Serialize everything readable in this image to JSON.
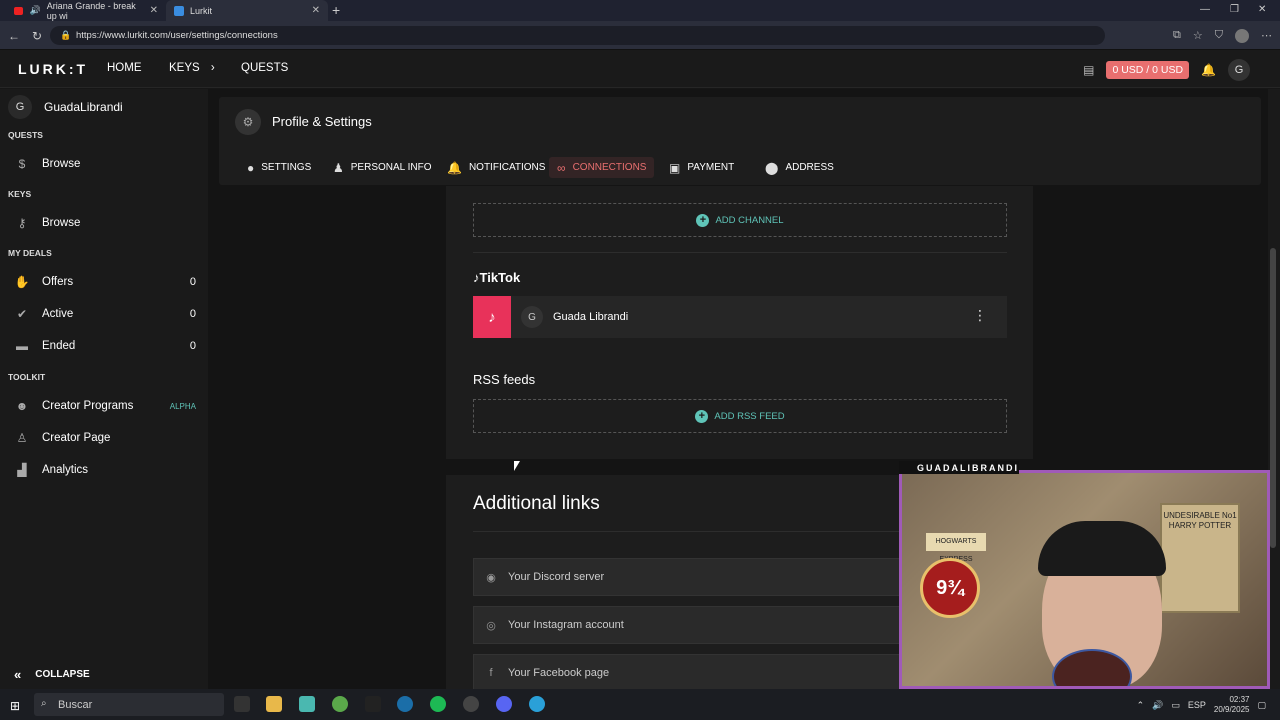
{
  "browser": {
    "tabs": [
      {
        "label": "Ariana Grande - break up wi",
        "icon": "youtube-icon"
      },
      {
        "label": "Lurkit",
        "icon": "lurkit-icon"
      }
    ],
    "url": "https://www.lurkit.com/user/settings/connections"
  },
  "topnav": {
    "logo": "LURK:T",
    "items": [
      "HOME",
      "KEYS",
      "QUESTS"
    ],
    "balance": "0 USD / 0 USD",
    "avatar": "G"
  },
  "sidebar": {
    "user_initial": "G",
    "username": "GuadaLibrandi",
    "sections": {
      "quests": "QUESTS",
      "keys": "KEYS",
      "my_deals": "MY DEALS",
      "toolkit": "TOOLKIT"
    },
    "quests_browse": "Browse",
    "keys_browse": "Browse",
    "deals": [
      {
        "label": "Offers",
        "count": "0"
      },
      {
        "label": "Active",
        "count": "0"
      },
      {
        "label": "Ended",
        "count": "0"
      }
    ],
    "toolkit": [
      {
        "label": "Creator Programs",
        "tag": "ALPHA"
      },
      {
        "label": "Creator Page"
      },
      {
        "label": "Analytics"
      }
    ],
    "collapse": "COLLAPSE"
  },
  "settings": {
    "title": "Profile & Settings",
    "tabs": [
      "SETTINGS",
      "PERSONAL INFO",
      "NOTIFICATIONS",
      "CONNECTIONS",
      "PAYMENT",
      "ADDRESS"
    ],
    "active_tab": "CONNECTIONS"
  },
  "connections": {
    "add_channel": "ADD CHANNEL",
    "tiktok_heading": "TikTok",
    "tiktok_avatar": "G",
    "tiktok_name": "Guada Librandi",
    "rss_heading": "RSS feeds",
    "add_rss": "ADD RSS FEED"
  },
  "additional": {
    "heading": "Additional links",
    "placeholders": [
      "Your Discord server",
      "Your Instagram account",
      "Your Facebook page"
    ]
  },
  "webcam": {
    "label": "GUADALIBRANDI",
    "poster": "UNDESIRABLE No1 HARRY POTTER",
    "sign": "HOGWARTS EXPRESS",
    "platform": "9¾"
  },
  "taskbar": {
    "search": "Buscar",
    "lang": "ESP",
    "time": "02:37",
    "date": "20/9/2025"
  },
  "colors": {
    "accent": "#e86f6f",
    "teal": "#5fc4b8",
    "tiktok": "#e8325a"
  }
}
